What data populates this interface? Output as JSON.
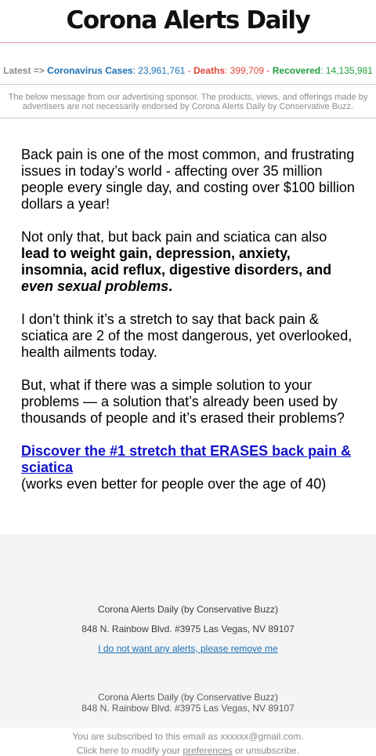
{
  "header": {
    "logo_text": "Corona Alerts Daily"
  },
  "ticker": {
    "latest": "Latest =>",
    "cases_label": "Coronavirus Cases",
    "cases_value": "23,961,761",
    "deaths_label": "Deaths",
    "deaths_value": "399,709",
    "recovered_label": "Recovered",
    "recovered_value": "14,135,981",
    "colors": {
      "cases": "#1a6fb4",
      "deaths": "#e0463c",
      "recovered": "#1f9e3a"
    }
  },
  "disclaimer": "The below message from our advertising sponsor. The products, views, and offerings made by advertisers are not necessarily endorsed by Corona Alerts Daily by Conservative Buzz.",
  "body": {
    "p1": "Back pain is one of the most common, and frustrating issues in today’s world - affecting over 35 million people every single day, and costing over $100 billion dollars a year!",
    "p2_start": "Not only that, but back pain and sciatica can also ",
    "p2_bold": "lead to weight gain, depression, anxiety, insomnia, acid reflux, digestive disorders, and ",
    "p2_bold_italic": "even sexual problems",
    "p2_end": ".",
    "p3": "I don’t think it’s a stretch to say that back pain & sciatica are 2 of the most dangerous, yet overlooked, health ailments today.",
    "p4": "But, what if there was a simple solution to your problems — a solution that’s already been used by thousands of people and it’s erased their problems?",
    "cta_link": "Discover the #1 stretch that ERASES back pain & sciatica",
    "cta_note": "(works even better for people over the age of 40)"
  },
  "footer": {
    "company": "Corona Alerts Daily (by Conservative Buzz)",
    "address": "848 N. Rainbow Blvd. #3975 Las Vegas, NV 89107",
    "remove_link": "I do not want any alerts, please remove me",
    "company2": "Corona Alerts Daily (by Conservative Buzz)",
    "address2": "848 N. Rainbow Blvd. #3975 Las Vegas, NV 89107"
  },
  "subscription": {
    "line1": "You are subscribed to this email as xxxxxx@gmail.com.",
    "line2_start": "Click here to modify your ",
    "preferences_link": "preferences",
    "line2_end": " or unsubscribe."
  }
}
